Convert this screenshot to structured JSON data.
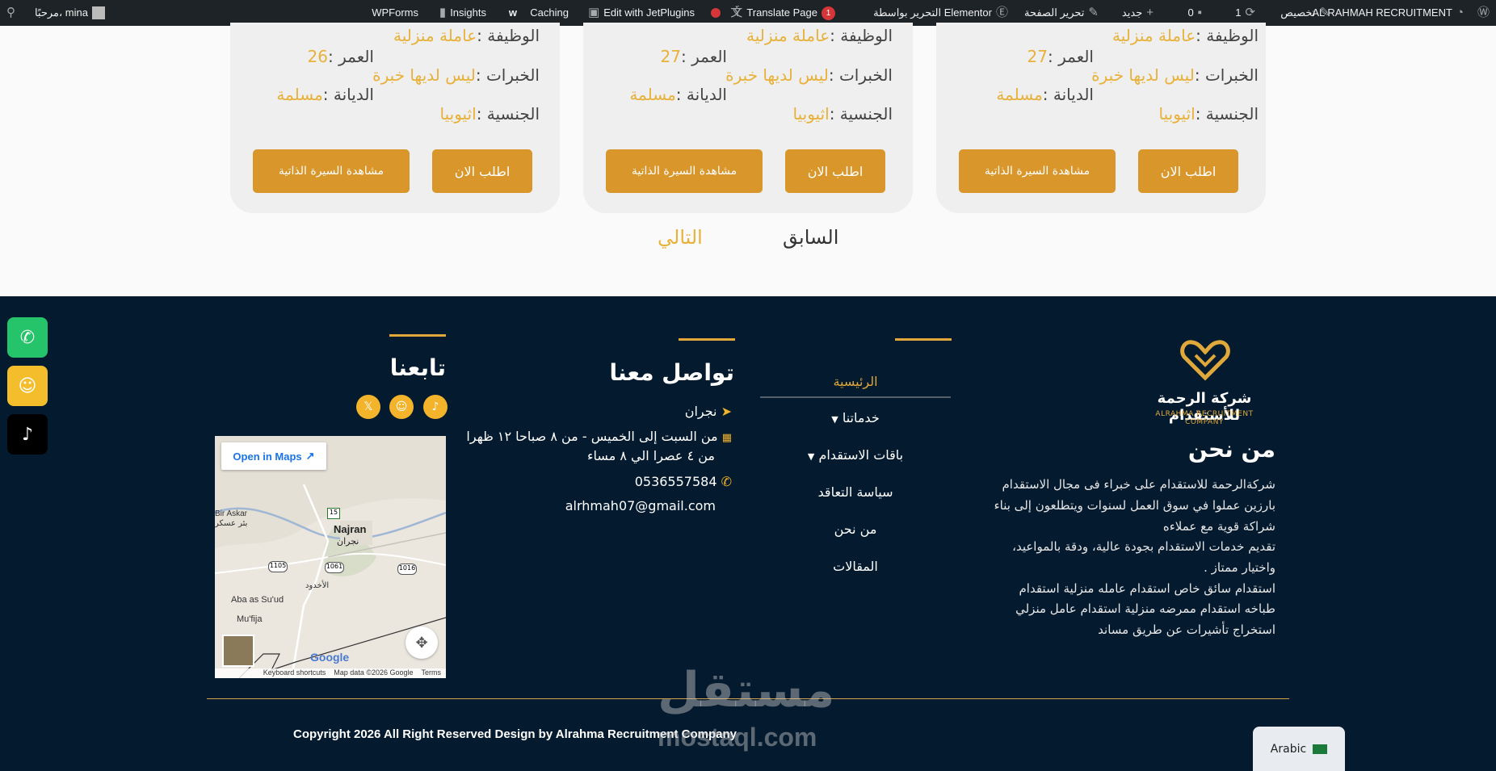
{
  "adminbar": {
    "site_name": "AL RAHMAH RECRUITMENT",
    "customize": "تخصيص",
    "updates_count": "1",
    "comments_count": "0",
    "new": "جديد",
    "edit_page": "تحرير الصفحة",
    "elementor": "التحرير بواسطة Elementor",
    "translate": "Translate Page",
    "translate_badge": "1",
    "jetplugins": "Edit with JetPlugins",
    "caching": "Caching",
    "insights": "Insights",
    "wpforms": "WPForms",
    "greeting": "مرحبًا، mina"
  },
  "cards": [
    {
      "job_label": "الوظيفة :",
      "job": "عاملة منزلية",
      "age_label": "العمر :",
      "age": "27",
      "exp_label": "الخبرات :",
      "exp": "ليس لديها خبرة",
      "religion_label": "الديانة :",
      "religion": "مسلمة",
      "nat_label": "الجنسية :",
      "nat": "اثيوبيا",
      "apply": "اطلب الان",
      "cv": "مشاهدة السيرة الذاتية"
    },
    {
      "job_label": "الوظيفة :",
      "job": "عاملة منزلية",
      "age_label": "العمر :",
      "age": "27",
      "exp_label": "الخبرات :",
      "exp": "ليس لديها خبرة",
      "religion_label": "الديانة :",
      "religion": "مسلمة",
      "nat_label": "الجنسية :",
      "nat": "اثيوبيا",
      "apply": "اطلب الان",
      "cv": "مشاهدة السيرة الذاتية"
    },
    {
      "job_label": "الوظيفة :",
      "job": "عاملة منزلية",
      "age_label": "العمر :",
      "age": "26",
      "exp_label": "الخبرات :",
      "exp": "ليس لديها خبرة",
      "religion_label": "الديانة :",
      "religion": "مسلمة",
      "nat_label": "الجنسية :",
      "nat": "اثيوبيا",
      "apply": "اطلب الان",
      "cv": "مشاهدة السيرة الذاتية"
    }
  ],
  "pagination": {
    "prev": "السابق",
    "next": "التالي"
  },
  "footer": {
    "logo_ar": "شركة الرحمة للأستقدام",
    "logo_en": "ALRAHMA RECRUITMENT COMPANY",
    "about_title": "من نحن",
    "about_lines": [
      "شركةالرحمة للاستقدام  على خبراء فى مجال الاستقدام",
      "بارزين عملوا في سوق العمل لسنوات ويتطلعون إلى بناء",
      "شراكة قوية مع عملاءه",
      "تقديم خدمات الاستقدام بجودة عالية، ودقة بالمواعيد،",
      "واختيار ممتاز .",
      "استقدام سائق خاص استقدام عامله منزلية استقدام",
      "طباخه استقدام ممرضه منزلية استقدام عامل منزلي",
      "استخراج تأشيرات عن طريق مساند"
    ],
    "menu": [
      "الرئيسية",
      "خدماتنا",
      "باقات الاستقدام",
      "سياسة التعاقد",
      "من نحن",
      "المقالات"
    ],
    "contact_title": "تواصل معنا",
    "city": "نجران",
    "hours_1": "من السبت إلى الخميس - من ٨ صباحا ١٢ ظهرا",
    "hours_2": "من ٤ عصرا الي ٨ مساء",
    "phone": "0536557584",
    "email": "alrhmah07@gmail.com",
    "follow_title": "تابعنا",
    "copyright": "Copyright 2026 All Right Reserved Design by Alrahma Recruitment Company"
  },
  "map": {
    "open_in_maps": "Open in Maps",
    "keyboard": "Keyboard shortcuts",
    "mapdata": "Map data ©2026 Google",
    "terms": "Terms",
    "google": "Google",
    "labels": {
      "bir_askar": "Bir Askar",
      "bir_askar_ar": "بئر عسكر",
      "najran": "Najran",
      "najran_ar": "نجران",
      "ukhdud": "الأخدود",
      "aba": "Aba as Su'ud",
      "mufija": "Mu'fija",
      "r15": "15",
      "r1105": "1105",
      "r1061": "1061",
      "r1016": "1016"
    }
  },
  "watermark": {
    "ar": "مستقل",
    "en": "mostaql.com"
  },
  "language": "Arabic",
  "colors": {
    "gold": "#e8b13a",
    "navy": "#041a2f",
    "button": "#d9962b"
  }
}
